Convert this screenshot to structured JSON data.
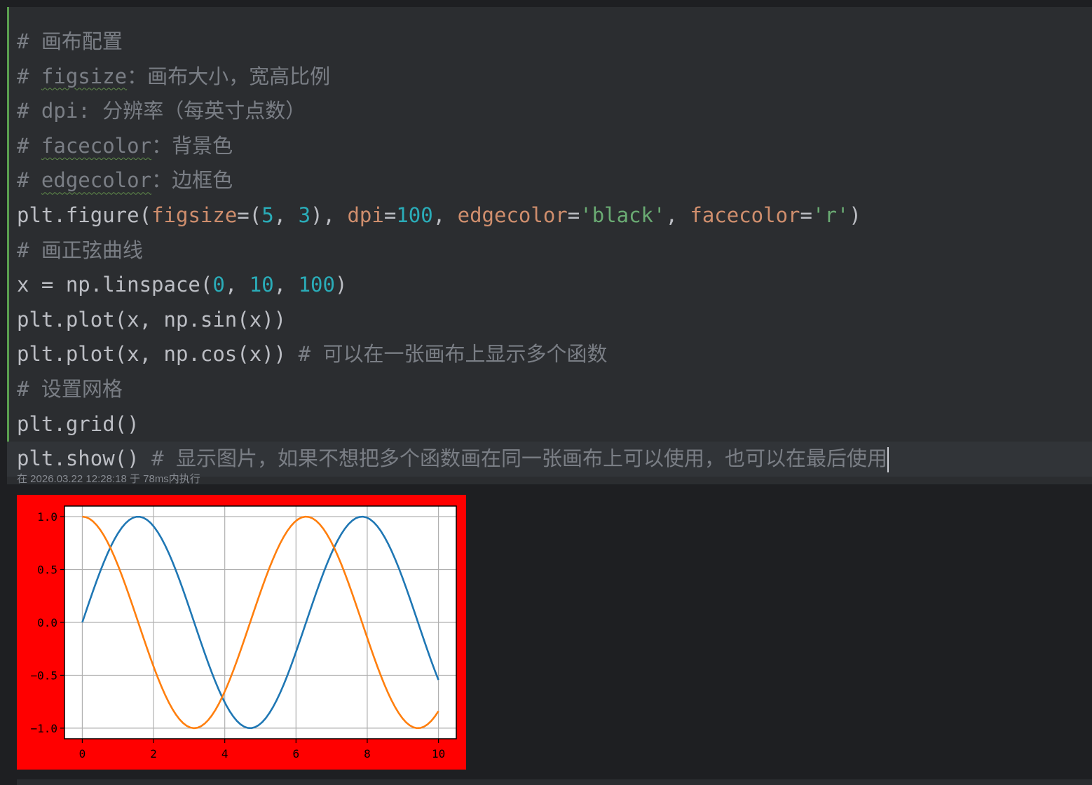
{
  "code_lines": [
    [
      {
        "t": "# 画布配置",
        "c": "cm"
      }
    ],
    [
      {
        "t": "# ",
        "c": "cm"
      },
      {
        "t": "figsize",
        "c": "cm sq"
      },
      {
        "t": "：画布大小，宽高比例",
        "c": "cm"
      }
    ],
    [
      {
        "t": "# dpi: 分辨率（每英寸点数）",
        "c": "cm"
      }
    ],
    [
      {
        "t": "# ",
        "c": "cm"
      },
      {
        "t": "facecolor",
        "c": "cm sq"
      },
      {
        "t": "：背景色",
        "c": "cm"
      }
    ],
    [
      {
        "t": "# ",
        "c": "cm"
      },
      {
        "t": "edgecolor",
        "c": "cm sq"
      },
      {
        "t": "：边框色",
        "c": "cm"
      }
    ],
    [
      {
        "t": "plt.figure(",
        "c": ""
      },
      {
        "t": "figsize",
        "c": "kw"
      },
      {
        "t": "=(",
        "c": ""
      },
      {
        "t": "5",
        "c": "num"
      },
      {
        "t": ", ",
        "c": ""
      },
      {
        "t": "3",
        "c": "num"
      },
      {
        "t": "), ",
        "c": ""
      },
      {
        "t": "dpi",
        "c": "kw"
      },
      {
        "t": "=",
        "c": ""
      },
      {
        "t": "100",
        "c": "num"
      },
      {
        "t": ", ",
        "c": ""
      },
      {
        "t": "edgecolor",
        "c": "kw"
      },
      {
        "t": "=",
        "c": ""
      },
      {
        "t": "'black'",
        "c": "str"
      },
      {
        "t": ", ",
        "c": ""
      },
      {
        "t": "facecolor",
        "c": "kw"
      },
      {
        "t": "=",
        "c": ""
      },
      {
        "t": "'r'",
        "c": "str"
      },
      {
        "t": ")",
        "c": ""
      }
    ],
    [
      {
        "t": "# 画正弦曲线",
        "c": "cm"
      }
    ],
    [
      {
        "t": "x = np.linspace(",
        "c": ""
      },
      {
        "t": "0",
        "c": "num"
      },
      {
        "t": ", ",
        "c": ""
      },
      {
        "t": "10",
        "c": "num"
      },
      {
        "t": ", ",
        "c": ""
      },
      {
        "t": "100",
        "c": "num"
      },
      {
        "t": ")",
        "c": ""
      }
    ],
    [
      {
        "t": "plt.plot(x, np.sin(x))",
        "c": ""
      }
    ],
    [
      {
        "t": "plt.plot(x, np.cos(x)) ",
        "c": ""
      },
      {
        "t": "# 可以在一张画布上显示多个函数",
        "c": "cm"
      }
    ],
    [
      {
        "t": "# 设置网格",
        "c": "cm"
      }
    ],
    [
      {
        "t": "plt.grid()",
        "c": ""
      }
    ],
    [
      {
        "t": "plt.show() ",
        "c": ""
      },
      {
        "t": "# 显示图片，如果不想把多个函数画在同一张画布上可以使用，也可以在最后使用",
        "c": "cm"
      }
    ]
  ],
  "exec_status": "在 2026.03.22 12:28:18 于 78ms内执行",
  "colors": {
    "figure_bg": "#ff0000",
    "axes_bg": "#ffffff",
    "sin": "#1f77b4",
    "cos": "#ff7f0e",
    "grid": "#b0b0b0"
  },
  "chart_data": {
    "type": "line",
    "x_range": [
      0,
      10
    ],
    "n_points": 100,
    "xlim": [
      -0.5,
      10.5
    ],
    "ylim": [
      -1.1,
      1.1
    ],
    "xticks": [
      0,
      2,
      4,
      6,
      8,
      10
    ],
    "xtick_labels": [
      "0",
      "2",
      "4",
      "6",
      "8",
      "10"
    ],
    "yticks": [
      -1.0,
      -0.5,
      0.0,
      0.5,
      1.0
    ],
    "ytick_labels": [
      "−1.0",
      "−0.5",
      "0.0",
      "0.5",
      "1.0"
    ],
    "grid": true,
    "series": [
      {
        "function": "sin",
        "color": "#1f77b4"
      },
      {
        "function": "cos",
        "color": "#ff7f0e"
      }
    ]
  }
}
